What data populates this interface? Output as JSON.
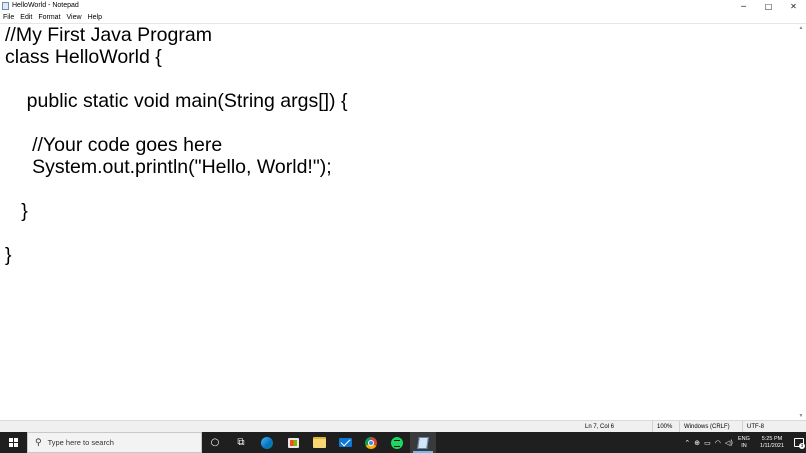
{
  "window": {
    "title": "HelloWorld - Notepad",
    "controls": {
      "minimize": "─",
      "maximize": "□",
      "close": "✕"
    }
  },
  "menu": {
    "items": [
      "File",
      "Edit",
      "Format",
      "View",
      "Help"
    ]
  },
  "editor": {
    "lines": [
      "//My First Java Program",
      "class HelloWorld {",
      "",
      "    public static void main(String args[]) {",
      "",
      "     //Your code goes here",
      "     System.out.println(\"Hello, World!\");",
      "",
      "   }",
      "",
      "}"
    ]
  },
  "status": {
    "position": "Ln 7, Col 6",
    "zoom": "100%",
    "line_ending": "Windows (CRLF)",
    "encoding": "UTF-8"
  },
  "taskbar": {
    "search_placeholder": "Type here to search",
    "apps": [
      "cortana-icon",
      "task-view-icon",
      "edge-icon",
      "store-icon",
      "file-explorer-icon",
      "mail-icon",
      "chrome-icon",
      "spotify-icon",
      "notepad-icon"
    ],
    "language_primary": "ENG",
    "language_secondary": "IN",
    "time": "5:25 PM",
    "date": "1/11/2021",
    "notification_count": "3"
  },
  "colors": {
    "taskbar_bg": "#1f1f1f",
    "active_indicator": "#76b9ed",
    "statusbar_bg": "#f0f0f0"
  }
}
